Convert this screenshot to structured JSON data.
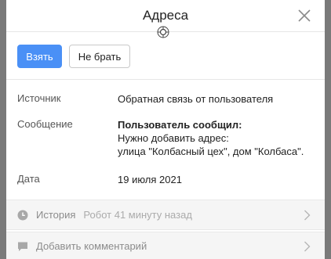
{
  "header": {
    "title": "Адреса"
  },
  "actions": {
    "take_label": "Взять",
    "skip_label": "Не брать"
  },
  "info": {
    "source_label": "Источник",
    "source_value": "Обратная связь от пользователя",
    "message_label": "Сообщение",
    "message_heading": "Пользователь сообщил:",
    "message_line1": "Нужно добавить адрес:",
    "message_line2": "улица \"Колбасный цех\", дом \"Колбаса\".",
    "date_label": "Дата",
    "date_value": "19 июля 2021"
  },
  "history": {
    "label": "История",
    "meta": "Робот 41 минуту назад"
  },
  "comment": {
    "label": "Добавить комментарий"
  },
  "icons": {
    "close": "close-icon",
    "crosshair": "crosshair-icon",
    "history": "clock-icon",
    "comment": "comment-icon",
    "chevron": "chevron-right-icon"
  },
  "colors": {
    "primary": "#4a90f6",
    "backdrop": "#7a7a7a"
  }
}
